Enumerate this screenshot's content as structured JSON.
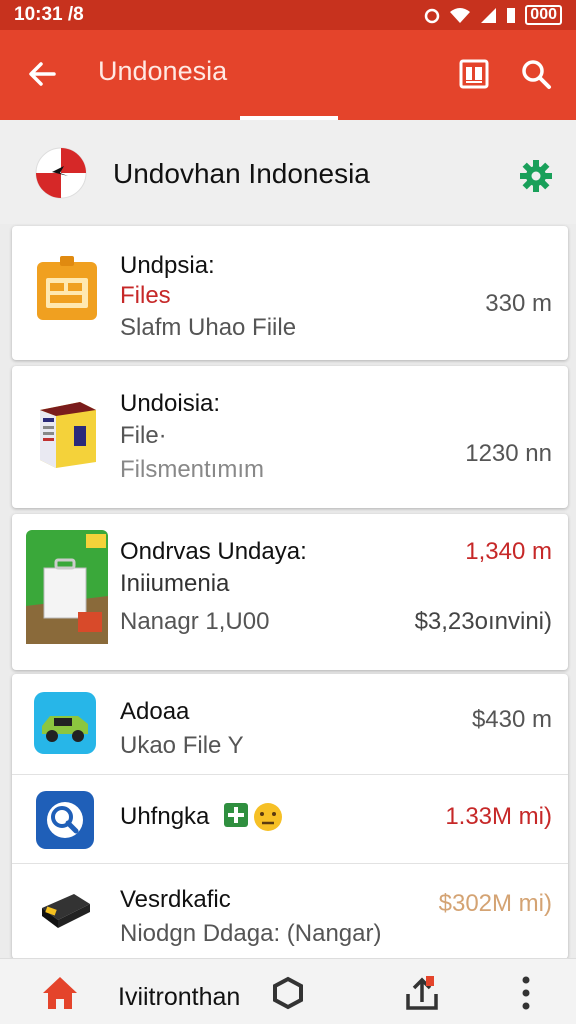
{
  "status_bar": {
    "time": "10:31 /8",
    "battery": "000"
  },
  "app_bar": {
    "title": "Undonesia"
  },
  "header": {
    "name": "Undovhan Indonesia"
  },
  "cards": [
    {
      "title": "Undpsia:",
      "subtitle": "Files",
      "subtitle2": "Slafm Uhao Fiile",
      "right": "330 m",
      "subtitle_color": "#c62828",
      "right_color": "#555555"
    },
    {
      "title": "Undoisia:",
      "subtitle": "File·",
      "subtitle2": "Filsmentımım",
      "right": "1230 nn",
      "right_color": "#555555"
    },
    {
      "title": "Ondrvas Undaya:",
      "subtitle": "Iniiumenia",
      "subtitle2": "Nanagr 1,U00",
      "right": "1,340 m",
      "right2": "$3,23oınvini)",
      "right_color": "#c62828"
    }
  ],
  "list": [
    {
      "title": "Adoaa",
      "subtitle": "Ukao File Y",
      "right": "$430 m",
      "right_color": "#555555"
    },
    {
      "title": "Uhfngka",
      "subtitle": "",
      "right": "1.33M mi)",
      "right_color": "#c62828"
    },
    {
      "title": "Vesrdkafic",
      "subtitle": "Niodgn Ddaga: (Nangar)",
      "right": "$302M mi)",
      "right_color": "#d4a373"
    }
  ],
  "bottom_bar": {
    "label": "Iviitronthan"
  },
  "colors": {
    "primary": "#e4442b",
    "status": "#c7321e",
    "accent_green": "#19a05a",
    "red_text": "#c62828"
  },
  "icons": [
    "back-arrow-icon",
    "layout-icon",
    "search-icon",
    "gear-icon",
    "home-icon",
    "hexagon-icon",
    "upload-icon",
    "more-vert-icon"
  ]
}
